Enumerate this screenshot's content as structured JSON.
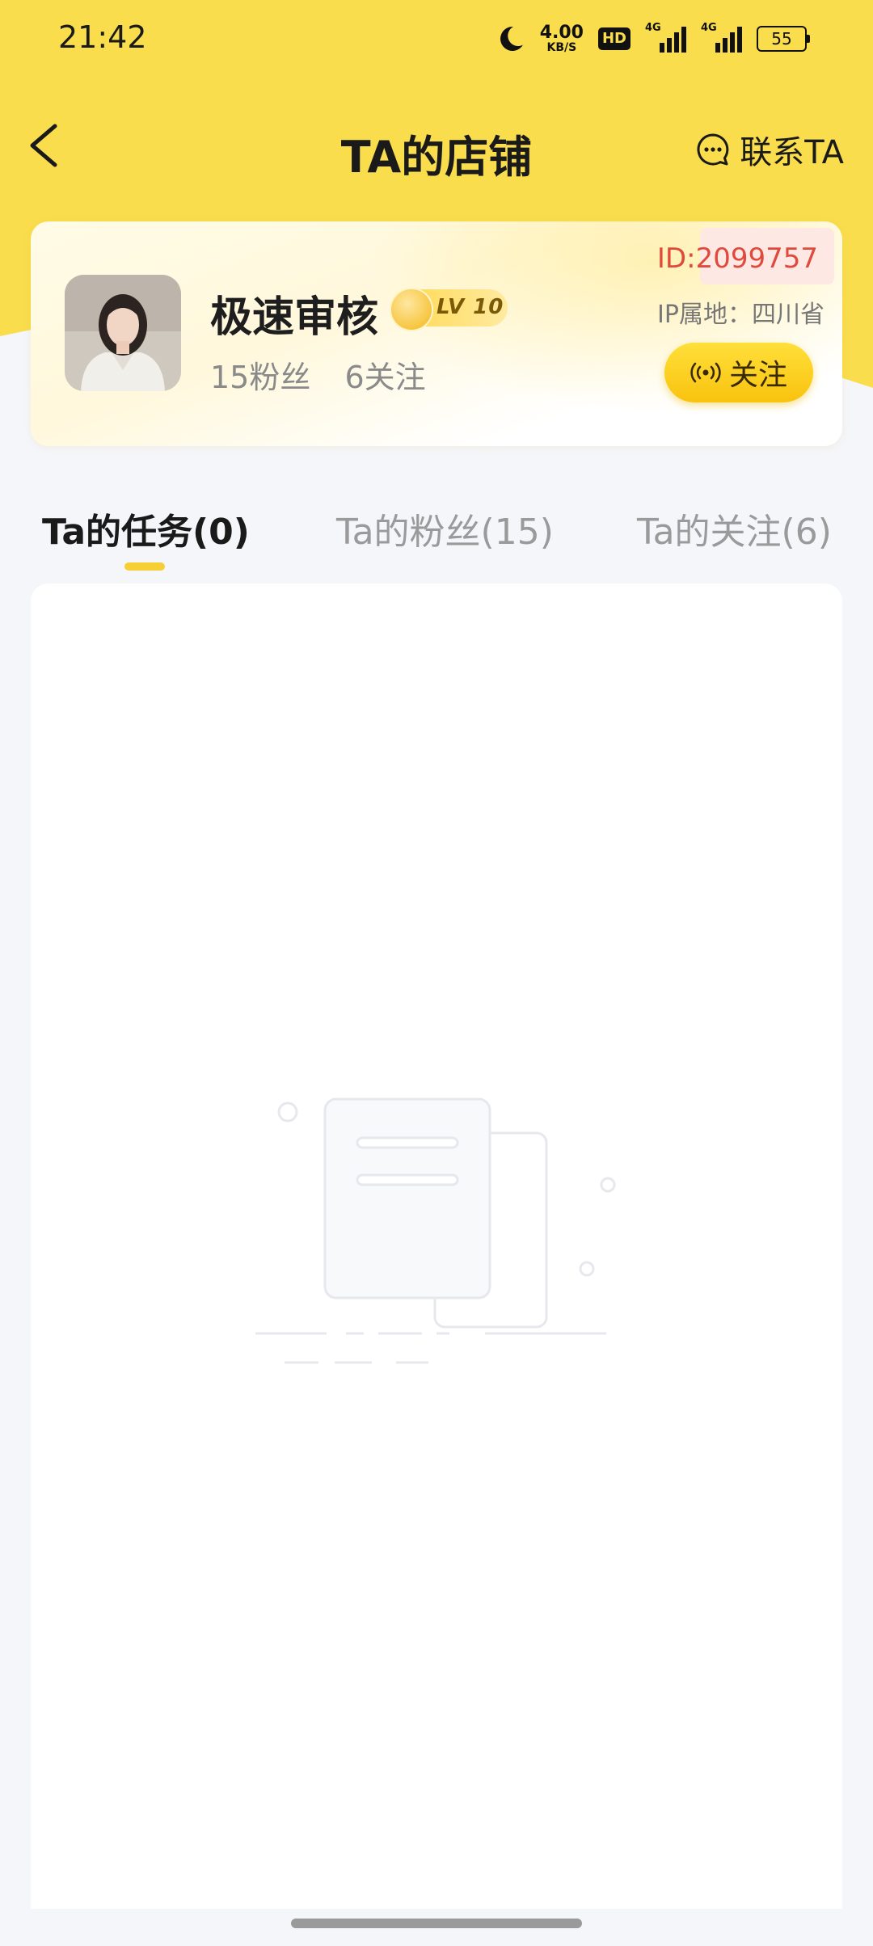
{
  "status_bar": {
    "time": "21:42",
    "net_speed_value": "4.00",
    "net_speed_unit": "KB/S",
    "hd_label": "HD",
    "signal1_label": "4G",
    "signal2_label": "4G",
    "battery_level": "55"
  },
  "nav": {
    "title": "TA的店铺",
    "contact_label": "联系TA",
    "back_icon": "chevron-left-icon",
    "contact_icon": "chat-bubble-icon"
  },
  "profile": {
    "name": "极速审核",
    "level": "LV 10",
    "fans": "15粉丝",
    "following": "6关注",
    "id": "ID:2099757",
    "ip_location": "IP属地：四川省",
    "follow_label": "关注"
  },
  "tabs": [
    {
      "label": "Ta的任务(0)",
      "active": true
    },
    {
      "label": "Ta的粉丝(15)",
      "active": false
    },
    {
      "label": "Ta的关注(6)",
      "active": false
    }
  ],
  "colors": {
    "brand_yellow": "#f9dd4d",
    "id_red": "#e04a3c",
    "page_bg": "#f5f6fa"
  }
}
